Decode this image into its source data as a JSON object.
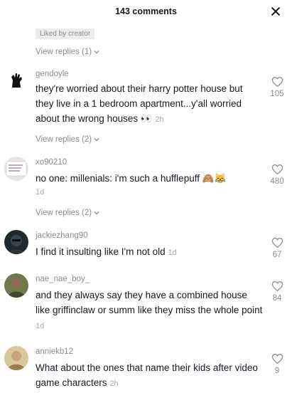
{
  "header": {
    "title": "143 comments"
  },
  "top": {
    "badge": "Liked by creator",
    "view_replies": "View replies (1)"
  },
  "comments": [
    {
      "username": "gendoyle",
      "text": "they're worried about their harry potter house but they live in a 1 bedroom apartment...y'all worried about the wrong houses 👀",
      "time": "2h",
      "likes": "105",
      "view_replies": "View replies (2)"
    },
    {
      "username": "xo90210",
      "text": "no one: millenials: i'm such a hufflepuff 🙈😹",
      "time": "1d",
      "likes": "480",
      "view_replies": "View replies (2)"
    },
    {
      "username": "jackiezhang90",
      "text": "I find it insulting like I'm not old",
      "time": "1d",
      "likes": "67"
    },
    {
      "username": "nae_nae_boy_",
      "text": "and they always say they have a combined house like griffinclaw or summ like they miss the whole point",
      "time": "1d",
      "likes": "84"
    },
    {
      "username": "anniekb12",
      "text": "What about the ones that name their kids after video game characters",
      "time": "2h",
      "likes": "9"
    }
  ]
}
